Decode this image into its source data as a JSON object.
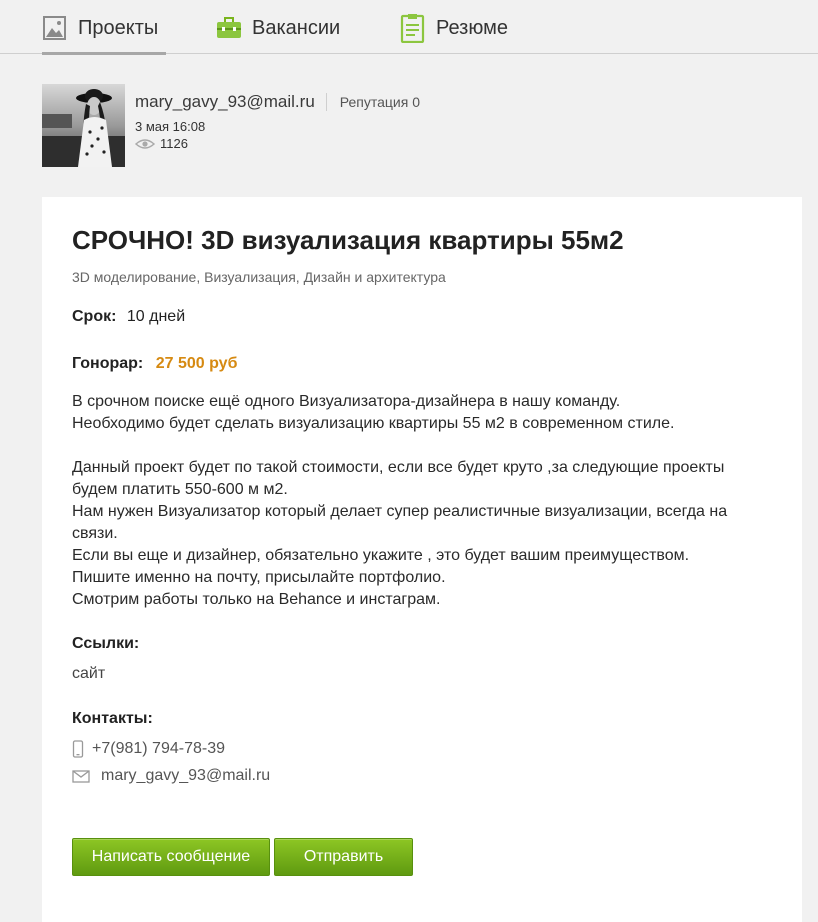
{
  "nav": {
    "tabs": [
      {
        "label": "Проекты",
        "icon": "image-icon",
        "active": true
      },
      {
        "label": "Вакансии",
        "icon": "briefcase-icon",
        "active": false
      },
      {
        "label": "Резюме",
        "icon": "clipboard-icon",
        "active": false
      }
    ]
  },
  "author": {
    "email": "mary_gavy_93@mail.ru",
    "reputation": "Репутация 0",
    "date": "3 мая 16:08",
    "views": "1126"
  },
  "project": {
    "title": "СРОЧНО! 3D визуализация квартиры 55м2",
    "categories": "3D моделирование, Визуализация, Дизайн и архитектура",
    "term_label": "Срок:",
    "term_value": "10 дней",
    "fee_label": "Гонорар:",
    "fee_value": "27 500 руб",
    "description": [
      "В срочном поиске ещё одного Визуализатора-дизайнера в нашу команду.",
      "Необходимо будет сделать визуализацию квартиры 55 м2 в современном стиле.",
      "Данный проект будет по такой стоимости, если все будет круто ,за следующие проекты будем платить 550-600 м м2.",
      "Нам нужен Визуализатор который делает супер реалистичные визуализации, всегда на связи.",
      "Если вы еще и дизайнер, обязательно укажите , это будет вашим преимуществом.",
      "Пишите именно на почту, присылайте портфолио.",
      "Смотрим работы только на Behance и инстаграм."
    ],
    "links_label": "Ссылки:",
    "link_text": "сайт",
    "contacts_label": "Контакты:",
    "phone": "+7(981) 794-78-39",
    "contact_email": "mary_gavy_93@mail.ru"
  },
  "buttons": {
    "write_message": "Написать сообщение",
    "send": "Отправить"
  },
  "colors": {
    "accent_green": "#7ab51d",
    "fee_orange": "#d68a12",
    "page_bg": "#f1f1f1"
  }
}
